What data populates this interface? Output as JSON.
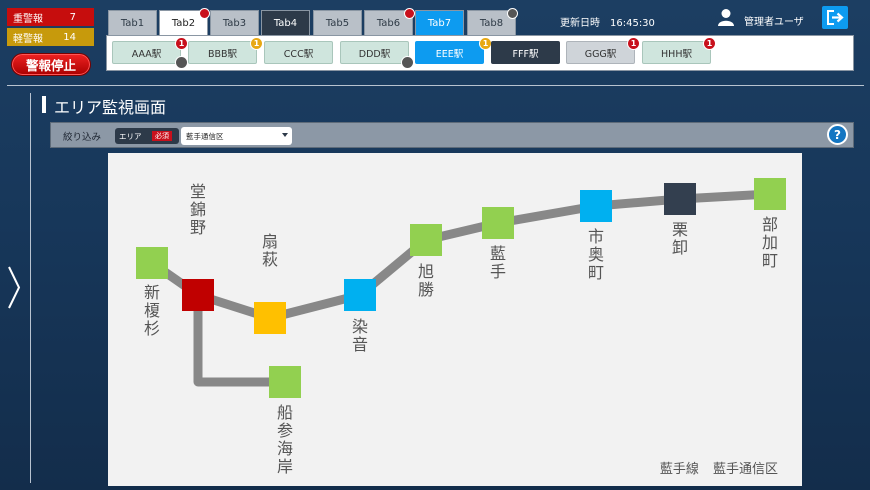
{
  "alarms": {
    "heavy_label": "重警報",
    "heavy_count": "7",
    "light_label": "軽警報",
    "light_count": "14"
  },
  "stop_label": "警報停止",
  "tabs": [
    {
      "label": "Tab1",
      "style": "gray"
    },
    {
      "label": "Tab2",
      "style": "white",
      "dot": "red"
    },
    {
      "label": "Tab3",
      "style": "gray"
    },
    {
      "label": "Tab4",
      "style": "dark"
    },
    {
      "label": "Tab5",
      "style": "gray"
    },
    {
      "label": "Tab6",
      "style": "gray",
      "dot": "red"
    },
    {
      "label": "Tab7",
      "style": "blue"
    },
    {
      "label": "Tab8",
      "style": "gray",
      "dot": "gray"
    }
  ],
  "stations": [
    {
      "label": "AAA駅",
      "style": "mint",
      "badge": "1",
      "badge_color": "red",
      "sub": "gray"
    },
    {
      "label": "BBB駅",
      "style": "mint",
      "badge": "1",
      "badge_color": "yellow"
    },
    {
      "label": "CCC駅",
      "style": "mint"
    },
    {
      "label": "DDD駅",
      "style": "mint",
      "sub": "gray"
    },
    {
      "label": "EEE駅",
      "style": "blue",
      "badge": "1",
      "badge_color": "yellow"
    },
    {
      "label": "FFF駅",
      "style": "dark"
    },
    {
      "label": "GGG駅",
      "style": "gray2",
      "badge": "1",
      "badge_color": "red"
    },
    {
      "label": "HHH駅",
      "style": "mint",
      "badge": "1",
      "badge_color": "red"
    }
  ],
  "updated": "更新日時　16:45:30",
  "user_name": "管理者ユーザ",
  "icons": {
    "user": "user-icon",
    "logout": "logout-icon",
    "help": "help-icon",
    "expand": "chevron-right-icon"
  },
  "page_title": "エリア監視画面",
  "filter": {
    "label": "絞り込み",
    "area_label": "エリア",
    "required_label": "必須",
    "area_value": "藍手通信区",
    "help": "?"
  },
  "map": {
    "nodes": [
      {
        "name": "新榎杉",
        "color": "#92d050"
      },
      {
        "name": "堂錦野",
        "color": "#c00000"
      },
      {
        "name": "扇萩",
        "color": "#ffc000"
      },
      {
        "name": "船参海岸",
        "color": "#92d050"
      },
      {
        "name": "染音",
        "color": "#00b0f0"
      },
      {
        "name": "旭勝",
        "color": "#92d050"
      },
      {
        "name": "藍手",
        "color": "#92d050"
      },
      {
        "name": "市奥町",
        "color": "#00b0f0"
      },
      {
        "name": "栗卸",
        "color": "#333f4f"
      },
      {
        "name": "部加町",
        "color": "#92d050"
      }
    ],
    "footer": "藍手線 藍手通信区"
  },
  "colors": {
    "heavy": "#c60d0d",
    "light": "#c79a0c",
    "accent": "#0d9bf0",
    "dark": "#2d3a49"
  }
}
